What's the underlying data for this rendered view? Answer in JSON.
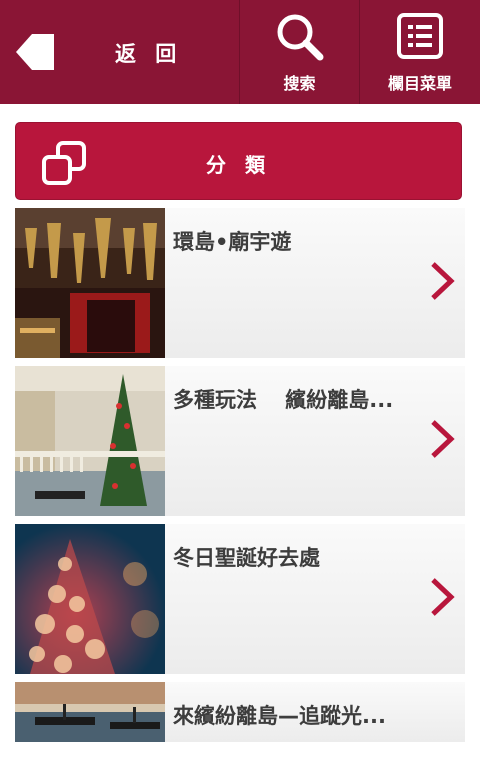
{
  "header": {
    "back_label": "返 回",
    "search_label": "搜索",
    "menu_label": "欄目菜單"
  },
  "category": {
    "label": "分 類"
  },
  "items": [
    {
      "title": "環島•廟宇遊"
    },
    {
      "title": "多種玩法　 繽紛離島..."
    },
    {
      "title": "冬日聖誕好去處"
    },
    {
      "title": "來繽紛離島—追蹤光..."
    }
  ],
  "colors": {
    "header_bg": "#8a1535",
    "accent": "#b8163c"
  }
}
